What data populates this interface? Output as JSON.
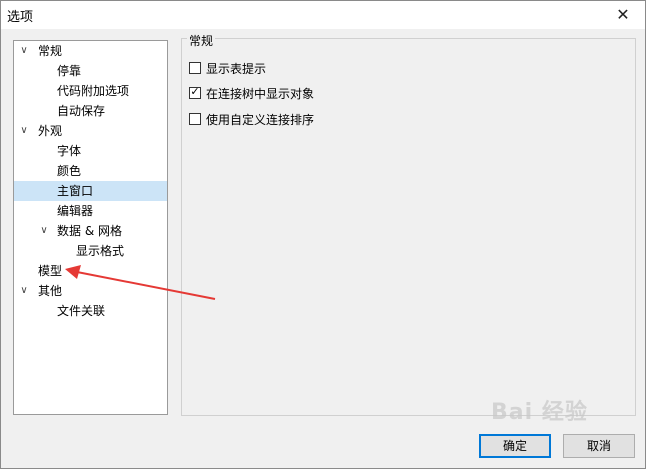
{
  "window": {
    "title": "选项",
    "close_glyph": "✕"
  },
  "tree": {
    "expand_glyph": "∨",
    "items": [
      {
        "label": "常规"
      },
      {
        "label": "停靠"
      },
      {
        "label": "代码附加选项"
      },
      {
        "label": "自动保存"
      },
      {
        "label": "外观"
      },
      {
        "label": "字体"
      },
      {
        "label": "颜色"
      },
      {
        "label": "主窗口",
        "selected": true
      },
      {
        "label": "编辑器"
      },
      {
        "label": "数据 & 网格"
      },
      {
        "label": "显示格式"
      },
      {
        "label": "模型"
      },
      {
        "label": "其他"
      },
      {
        "label": "文件关联"
      }
    ]
  },
  "panel": {
    "title": "常规",
    "options": [
      {
        "label": "显示表提示",
        "checked": false
      },
      {
        "label": "在连接树中显示对象",
        "checked": true
      },
      {
        "label": "使用自定义连接排序",
        "checked": false
      }
    ]
  },
  "buttons": {
    "ok": "确定",
    "cancel": "取消"
  },
  "watermark": "Bai 经验",
  "annotation": {
    "color": "#e53935"
  }
}
